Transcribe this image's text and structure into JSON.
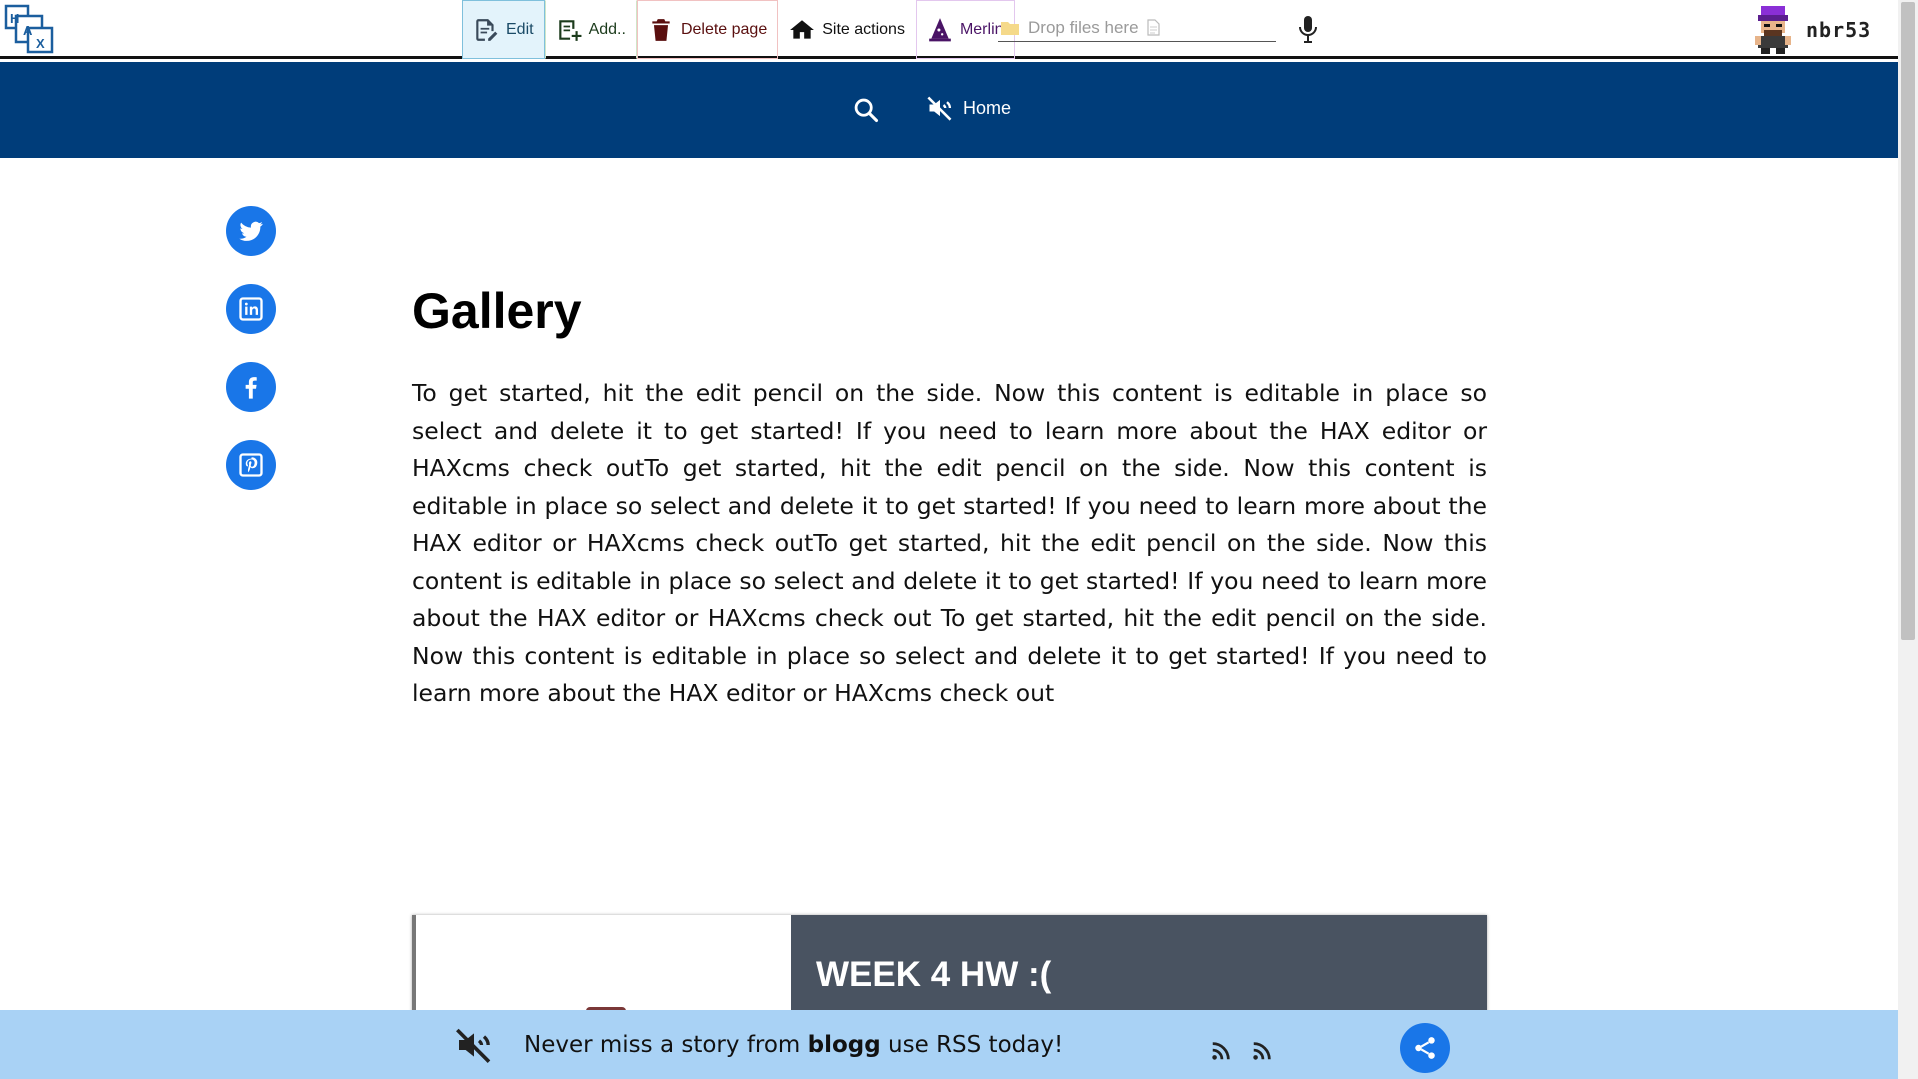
{
  "toolbar": {
    "edit_label": "Edit",
    "add_label": "Add..",
    "delete_label": "Delete page",
    "site_actions_label": "Site actions",
    "merlin_label": "Merlin",
    "drop_placeholder": "Drop files here",
    "username": "nbr53"
  },
  "header": {
    "home_label": "Home",
    "background_color": "#003d7a"
  },
  "social": {
    "items": [
      "twitter-icon",
      "linkedin-icon",
      "facebook-icon",
      "pinterest-icon"
    ],
    "color": "#1976e8"
  },
  "main": {
    "title": "Gallery",
    "body": "To get started, hit the edit pencil on the side. Now this content is editable in place so select and delete it to get started! If you need to learn more about the HAX editor or HAXcms check outTo get started, hit the edit pencil on the side. Now this content is editable in place so select and delete it to get started! If you need to learn more about the HAX editor or HAXcms check outTo get started, hit the edit pencil on the side. Now this content is editable in place so select and delete it to get started! If you need to learn more about the HAX editor or HAXcms check out To get started, hit the edit pencil on the side. Now this content is editable in place so select and delete it to get started! If you need to learn more about the HAX editor or HAXcms check out"
  },
  "card": {
    "title": "WEEK 4 HW :("
  },
  "footer": {
    "message_before": "Never miss a story from ",
    "site_name": "blogg",
    "message_after": " use RSS today!",
    "background_color": "#a9d2f5"
  }
}
